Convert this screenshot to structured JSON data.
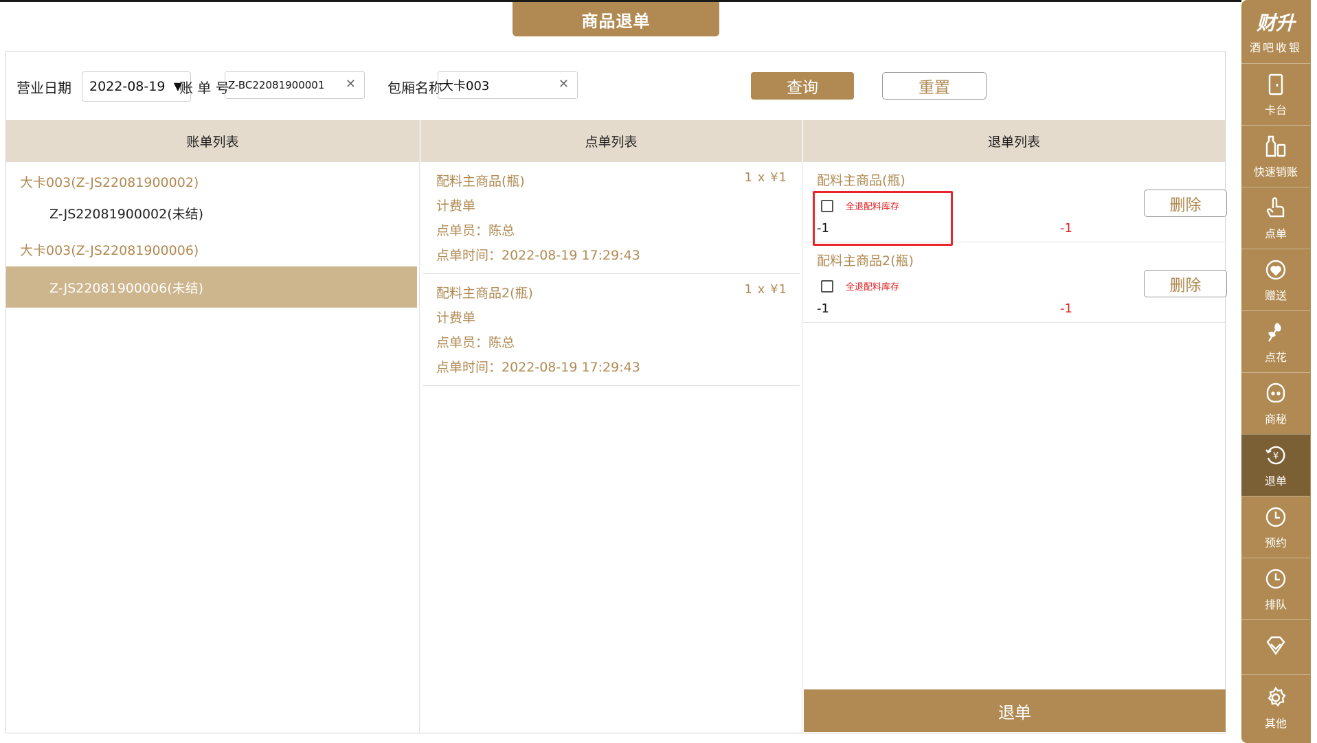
{
  "page_title": "商品退单",
  "search": {
    "date_label": "营业日期",
    "date_value": "2022-08-19",
    "bill_no_label": "账 单 号",
    "bill_no_value": "Z-BC22081900001",
    "room_label": "包厢名称",
    "room_value": "大卡003",
    "query_label": "查询",
    "reset_label": "重置"
  },
  "columns": {
    "bills": "账单列表",
    "orders": "点单列表",
    "returns": "退单列表"
  },
  "bill_list": [
    {
      "group": "大卡003(Z-JS22081900002)",
      "item": "Z-JS22081900002(未结)"
    },
    {
      "group": "大卡003(Z-JS22081900006)",
      "item": "Z-JS22081900006(未结)"
    }
  ],
  "order_list": [
    {
      "name": "配料主商品(瓶)",
      "qty": "1 x ¥1",
      "type": "计费单",
      "staff": "点单员：陈总",
      "time": "点单时间：2022-08-19 17:29:43"
    },
    {
      "name": "配料主商品2(瓶)",
      "qty": "1 x ¥1",
      "type": "计费单",
      "staff": "点单员：陈总",
      "time": "点单时间：2022-08-19 17:29:43"
    }
  ],
  "return_list": [
    {
      "name": "配料主商品(瓶)",
      "checkbox_label": "全退配料库存",
      "qty_left": "-1",
      "qty_right": "-1",
      "delete_label": "删除"
    },
    {
      "name": "配料主商品2(瓶)",
      "checkbox_label": "全退配料库存",
      "qty_left": "-1",
      "qty_right": "-1",
      "delete_label": "删除"
    }
  ],
  "submit_label": "退单",
  "brand": {
    "logo": "财升",
    "sub": "酒吧收银"
  },
  "sidebar": [
    {
      "label": "卡台",
      "icon": "door-icon"
    },
    {
      "label": "快速销账",
      "icon": "bottle-icon"
    },
    {
      "label": "点单",
      "icon": "hand-pointer-icon"
    },
    {
      "label": "赠送",
      "icon": "gift-heart-icon"
    },
    {
      "label": "点花",
      "icon": "flower-icon"
    },
    {
      "label": "商秘",
      "icon": "face-icon"
    },
    {
      "label": "退单",
      "icon": "refund-icon",
      "active": true
    },
    {
      "label": "预约",
      "icon": "clock-icon"
    },
    {
      "label": "排队",
      "icon": "clock-icon"
    },
    {
      "label": "",
      "icon": "diamond-icon"
    },
    {
      "label": "其他",
      "icon": "gear-icon"
    }
  ],
  "colors": {
    "accent": "#b08a52",
    "header_bg": "#e5dbcd",
    "active_row": "#cdb58d",
    "warning": "#e02020"
  }
}
